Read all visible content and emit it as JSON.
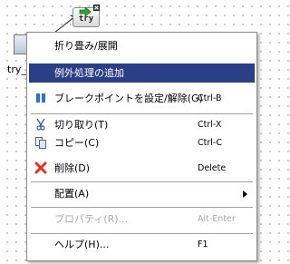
{
  "canvas": {
    "try_node_label": "try",
    "left_node_label": "try_c"
  },
  "menu": {
    "items": [
      {
        "label": "折り畳み/展開",
        "shortcut": "",
        "icon": "",
        "state": "normal"
      },
      {
        "label": "例外処理の追加",
        "shortcut": "",
        "icon": "",
        "state": "selected"
      },
      {
        "label": "ブレークポイントを設定/解除(G)",
        "shortcut": "Ctrl-B",
        "icon": "breakpoint-icon",
        "state": "normal"
      },
      {
        "label": "切り取り(T)",
        "shortcut": "Ctrl-X",
        "icon": "cut-icon",
        "state": "normal"
      },
      {
        "label": "コピー(C)",
        "shortcut": "Ctrl-C",
        "icon": "copy-icon",
        "state": "normal"
      },
      {
        "label": "削除(D)",
        "shortcut": "Delete",
        "icon": "delete-icon",
        "state": "normal"
      },
      {
        "label": "配置(A)",
        "shortcut": "",
        "icon": "submenu-arrow-icon",
        "state": "normal"
      },
      {
        "label": "プロパティ(R)...",
        "shortcut": "Alt-Enter",
        "icon": "",
        "state": "disabled"
      },
      {
        "label": "ヘルプ(H)...",
        "shortcut": "F1",
        "icon": "",
        "state": "normal"
      }
    ]
  },
  "colors": {
    "selection": "#2b3f86",
    "disabled_text": "#a9a9a9"
  }
}
